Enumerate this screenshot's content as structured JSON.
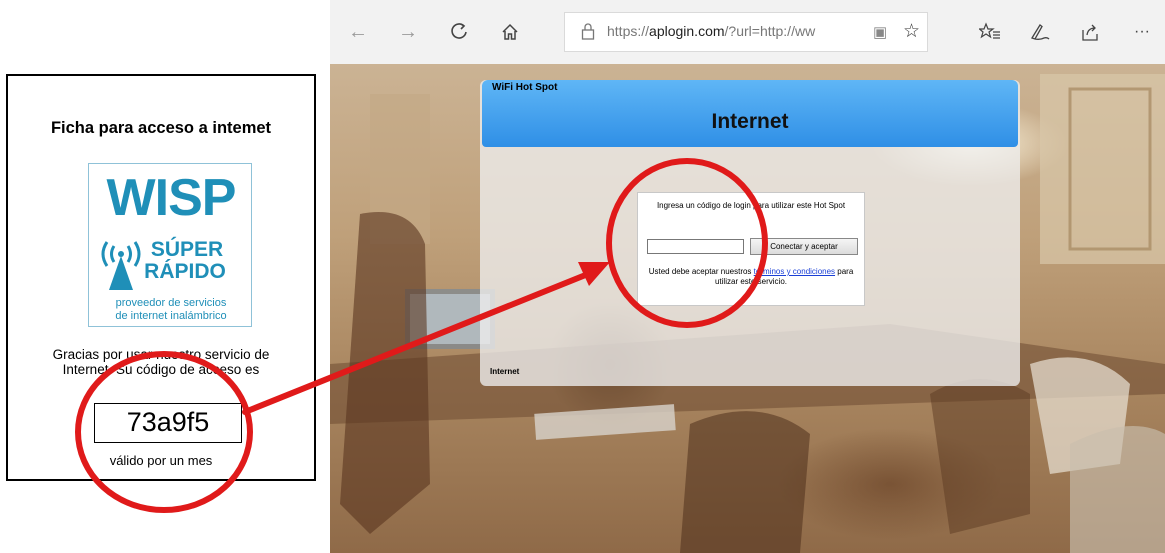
{
  "ticket": {
    "title": "Ficha para acceso a intemet",
    "logo": {
      "brand": "WISP",
      "tagline_line1": "SÚPER",
      "tagline_line2": "RÁPIDO",
      "desc_line1": "proveedor de servicios",
      "desc_line2": "de internet inalámbrico",
      "color": "#1f8fb8"
    },
    "thanks_line1": "Gracias por usar nuestro servicio de",
    "thanks_line2": "Internet. Su código de acceso es",
    "code": "73a9f5",
    "validity": "válido por un mes"
  },
  "browser": {
    "url_prefix": "https://",
    "url_domain": "aplogin.com",
    "url_rest": "/?url=http://ww",
    "toolbar_icons": [
      "back-icon",
      "forward-icon",
      "refresh-icon",
      "home-icon",
      "favorites-icon",
      "pen-icon",
      "share-icon",
      "more-icon"
    ],
    "more_label": "···"
  },
  "hotspot": {
    "small_title": "WiFi Hot Spot",
    "title": "Internet",
    "prompt": "Ingresa un código de login para utilizar este Hot Spot",
    "input_value": "",
    "button_label": "Conectar y aceptar",
    "terms_before": "Usted debe aceptar nuestros",
    "terms_link": "términos y condiciones",
    "terms_after": "para utilizar este servicio.",
    "footer": "Internet",
    "header_color": "#2f8fe6"
  },
  "annotation": {
    "color": "#e01a1a"
  }
}
